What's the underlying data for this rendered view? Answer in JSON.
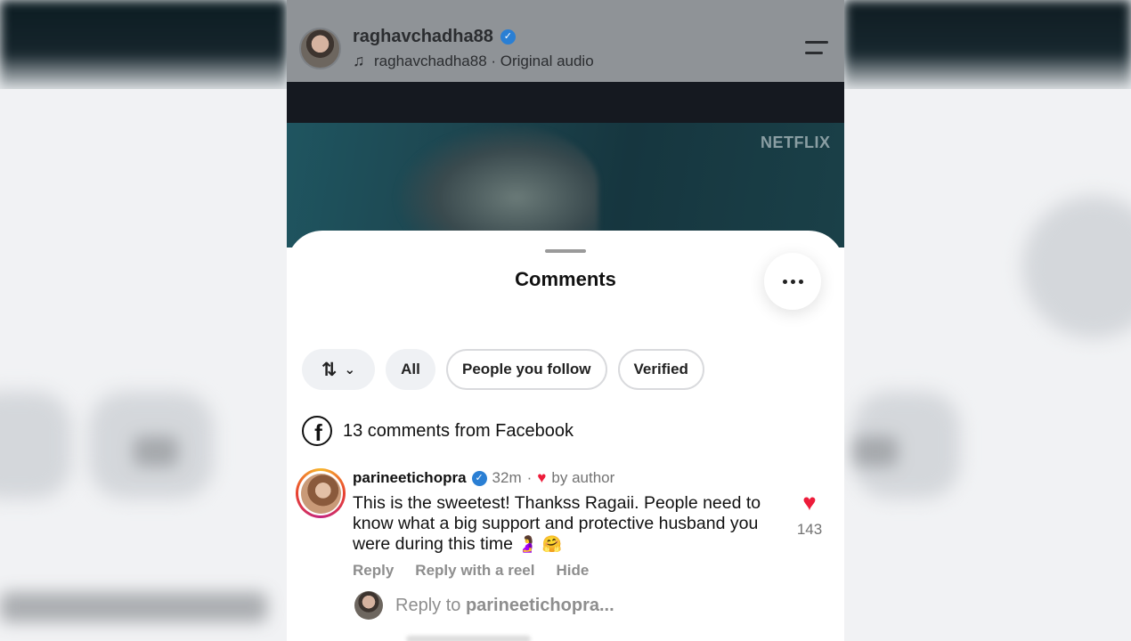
{
  "reel": {
    "username": "raghavchadha88",
    "audio": "raghavchadha88 · Original audio",
    "watermark": "NETFLIX",
    "icons": {
      "audio": "music-note-icon",
      "menu": "menu-icon",
      "verified": "verified-badge-icon"
    }
  },
  "comments": {
    "title": "Comments",
    "more_icon": "more-icon",
    "filters": {
      "sort_icon": "sort-icon",
      "chevron_icon": "chevron-down-icon",
      "all": "All",
      "people_you_follow": "People you follow",
      "verified": "Verified"
    },
    "facebook": {
      "icon": "facebook-icon",
      "text": "13 comments from Facebook"
    },
    "items": [
      {
        "username": "parineetichopra",
        "time": "32m",
        "separator": "·",
        "author_like": "by author",
        "text": "This is the sweetest! Thankss Ragaii. People need to know what a big support and protective husband you were during this time",
        "emoji": "🤰 🤗",
        "like_count": "143",
        "actions": {
          "reply": "Reply",
          "reply_with_reel": "Reply with a reel",
          "hide": "Hide"
        }
      }
    ],
    "reply_box": {
      "prefix": "Reply to",
      "target": "parineetichopra..."
    }
  },
  "colors": {
    "like": "#ed1c3a",
    "verified": "#2a7fd4",
    "muted_text": "#737373"
  }
}
